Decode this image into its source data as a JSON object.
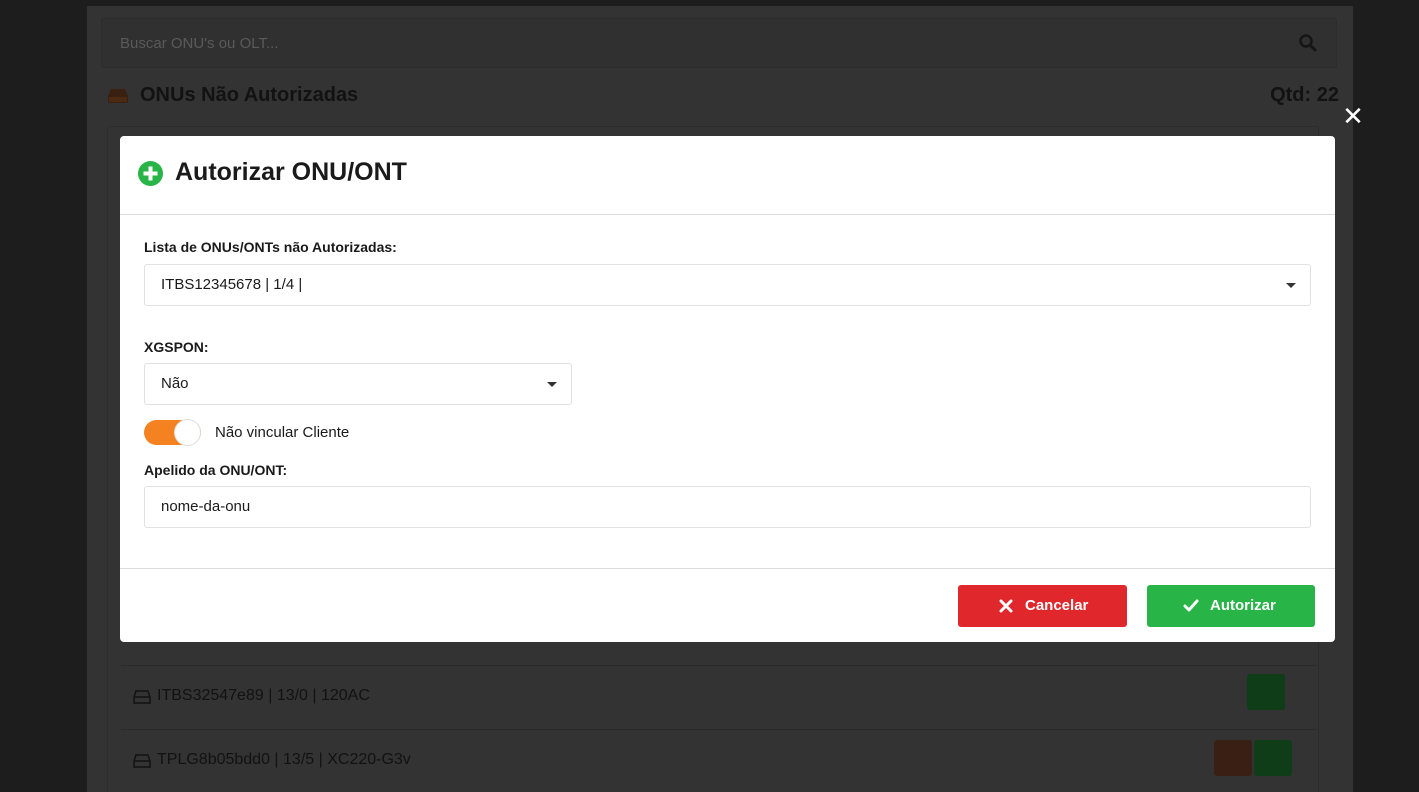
{
  "background": {
    "search_placeholder": "Buscar ONU's ou OLT...",
    "section_title": "ONUs Não Autorizadas",
    "qtd_label": "Qtd: 22",
    "rows": [
      {
        "text": "ITBS32547e89 | 13/0 | 120AC"
      },
      {
        "text": "TPLG8b05bdd0 | 13/5 | XC220-G3v"
      }
    ]
  },
  "overlay": {
    "close_symbol": "✕"
  },
  "modal": {
    "title": "Autorizar ONU/ONT",
    "onu_list_label": "Lista de ONUs/ONTs não Autorizadas:",
    "onu_list_value": "ITBS12345678 | 1/4 |",
    "xgspon_label": "XGSPON:",
    "xgspon_value": "Não",
    "toggle_label": "Não vincular Cliente",
    "toggle_on": true,
    "nickname_label": "Apelido da ONU/ONT:",
    "nickname_value": "nome-da-onu",
    "cancel_label": "Cancelar",
    "authorize_label": "Autorizar"
  },
  "colors": {
    "accent_green": "#28b446",
    "cancel_red": "#e0282c",
    "toggle_orange": "#f58220"
  }
}
